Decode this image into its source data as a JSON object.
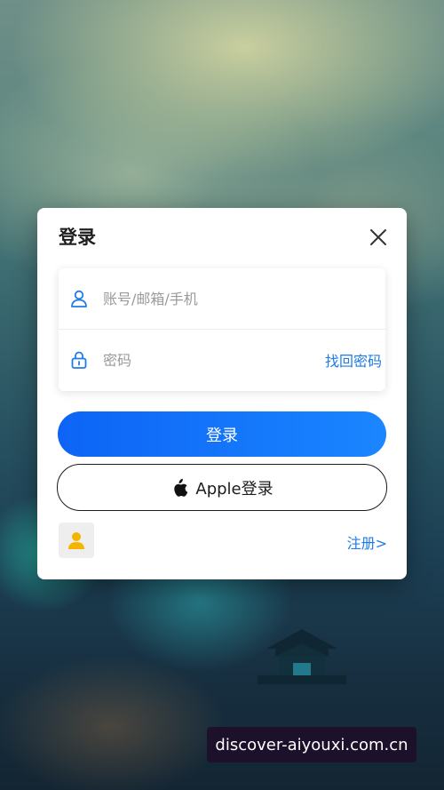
{
  "dialog": {
    "title": "登录",
    "username_placeholder": "账号/邮箱/手机",
    "password_placeholder": "密码",
    "find_password": "找回密码",
    "login_button": "登录",
    "apple_login_button": "Apple登录",
    "register_link": "注册>"
  },
  "watermark": {
    "text": "discover-aiyouxi.com.cn"
  },
  "colors": {
    "accent": "#1f7be6",
    "login_gradient_start": "#0d64f6",
    "login_gradient_end": "#1a86ff",
    "avatar_figure": "#f5b400"
  },
  "icons": {
    "close": "close-icon",
    "user": "user-icon",
    "lock": "lock-icon",
    "apple": "apple-icon",
    "avatar": "person-icon"
  }
}
